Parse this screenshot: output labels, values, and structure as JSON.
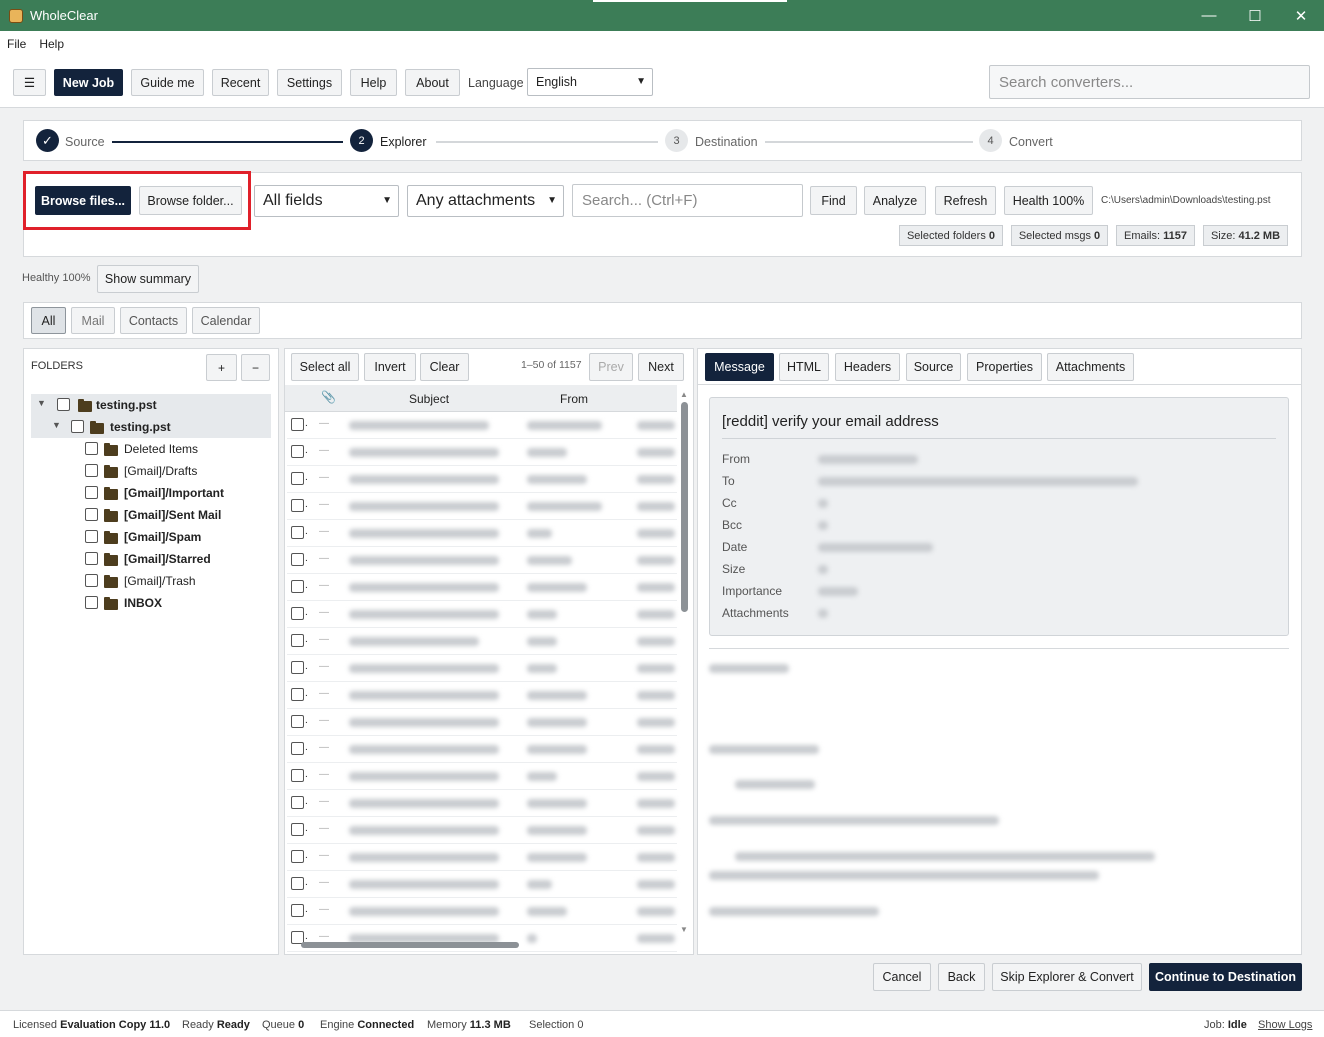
{
  "window": {
    "title": "WholeClear",
    "min": "—",
    "max": "☐",
    "close": "✕"
  },
  "menu": {
    "file": "File",
    "help": "Help"
  },
  "toolbar": {
    "menu_icon": "☰",
    "new_job": "New Job",
    "guide_me": "Guide me",
    "recent": "Recent",
    "settings": "Settings",
    "help": "Help",
    "about": "About",
    "language_label": "Language",
    "language_value": "English",
    "search_placeholder": "Search converters..."
  },
  "steps": [
    {
      "label": "Source",
      "marker": "✓",
      "state": "done"
    },
    {
      "label": "Explorer",
      "marker": "2",
      "state": "active"
    },
    {
      "label": "Destination",
      "marker": "3",
      "state": "pending"
    },
    {
      "label": "Convert",
      "marker": "4",
      "state": "pending"
    }
  ],
  "filters": {
    "browse_files": "Browse files...",
    "browse_folder": "Browse folder...",
    "field_select": "All fields",
    "attachment_select": "Any attachments",
    "search_placeholder": "Search... (Ctrl+F)",
    "find": "Find",
    "analyze": "Analyze",
    "refresh": "Refresh",
    "health": "Health 100%",
    "path": "C:\\Users\\admin\\Downloads\\testing.pst",
    "selected_folders_label": "Selected folders",
    "selected_folders_value": "0",
    "selected_msgs_label": "Selected msgs",
    "selected_msgs_value": "0",
    "emails_label": "Emails:",
    "emails_value": "1157",
    "size_label": "Size:",
    "size_value": "41.2 MB",
    "highlight_color": "#e0202a"
  },
  "summary": {
    "healthy": "Healthy 100%",
    "show_summary": "Show summary"
  },
  "type_tabs": [
    "All",
    "Mail",
    "Contacts",
    "Calendar"
  ],
  "folders": {
    "header": "FOLDERS",
    "add": "+",
    "remove": "−",
    "items": [
      {
        "label": "testing.pst",
        "bold": true,
        "level": 0,
        "expanded": true
      },
      {
        "label": "testing.pst",
        "bold": true,
        "level": 1,
        "expanded": true
      },
      {
        "label": "Deleted Items",
        "bold": false,
        "level": 2
      },
      {
        "label": "[Gmail]/Drafts",
        "bold": false,
        "level": 2
      },
      {
        "label": "[Gmail]/Important",
        "bold": true,
        "level": 2
      },
      {
        "label": "[Gmail]/Sent Mail",
        "bold": true,
        "level": 2
      },
      {
        "label": "[Gmail]/Spam",
        "bold": true,
        "level": 2
      },
      {
        "label": "[Gmail]/Starred",
        "bold": true,
        "level": 2
      },
      {
        "label": "[Gmail]/Trash",
        "bold": false,
        "level": 2
      },
      {
        "label": "INBOX",
        "bold": true,
        "level": 2
      }
    ]
  },
  "messages": {
    "select_all": "Select all",
    "invert": "Invert",
    "clear": "Clear",
    "range": "1–50 of 1157",
    "prev": "Prev",
    "next": "Next",
    "col_subject": "Subject",
    "col_from": "From",
    "dash": "—",
    "row_count": 20
  },
  "preview": {
    "tabs": [
      "Message",
      "HTML",
      "Headers",
      "Source",
      "Properties",
      "Attachments"
    ],
    "subject": "[reddit] verify your email address",
    "fields": [
      "From",
      "To",
      "Cc",
      "Bcc",
      "Date",
      "Size",
      "Importance",
      "Attachments"
    ]
  },
  "footer": {
    "cancel": "Cancel",
    "back": "Back",
    "skip": "Skip Explorer & Convert",
    "continue": "Continue to Destination"
  },
  "status": {
    "licensed_label": "Licensed",
    "licensed_value": "Evaluation Copy 11.0",
    "ready_label": "Ready",
    "ready_value": "Ready",
    "queue_label": "Queue",
    "queue_value": "0",
    "engine_label": "Engine",
    "engine_value": "Connected",
    "memory_label": "Memory",
    "memory_value": "11.3 MB",
    "selection_label": "Selection",
    "selection_value": "0",
    "job_label": "Job:",
    "job_value": "Idle",
    "show_logs": "Show Logs"
  },
  "colors": {
    "titlebar": "#3c7d57",
    "primary": "#13233c"
  }
}
